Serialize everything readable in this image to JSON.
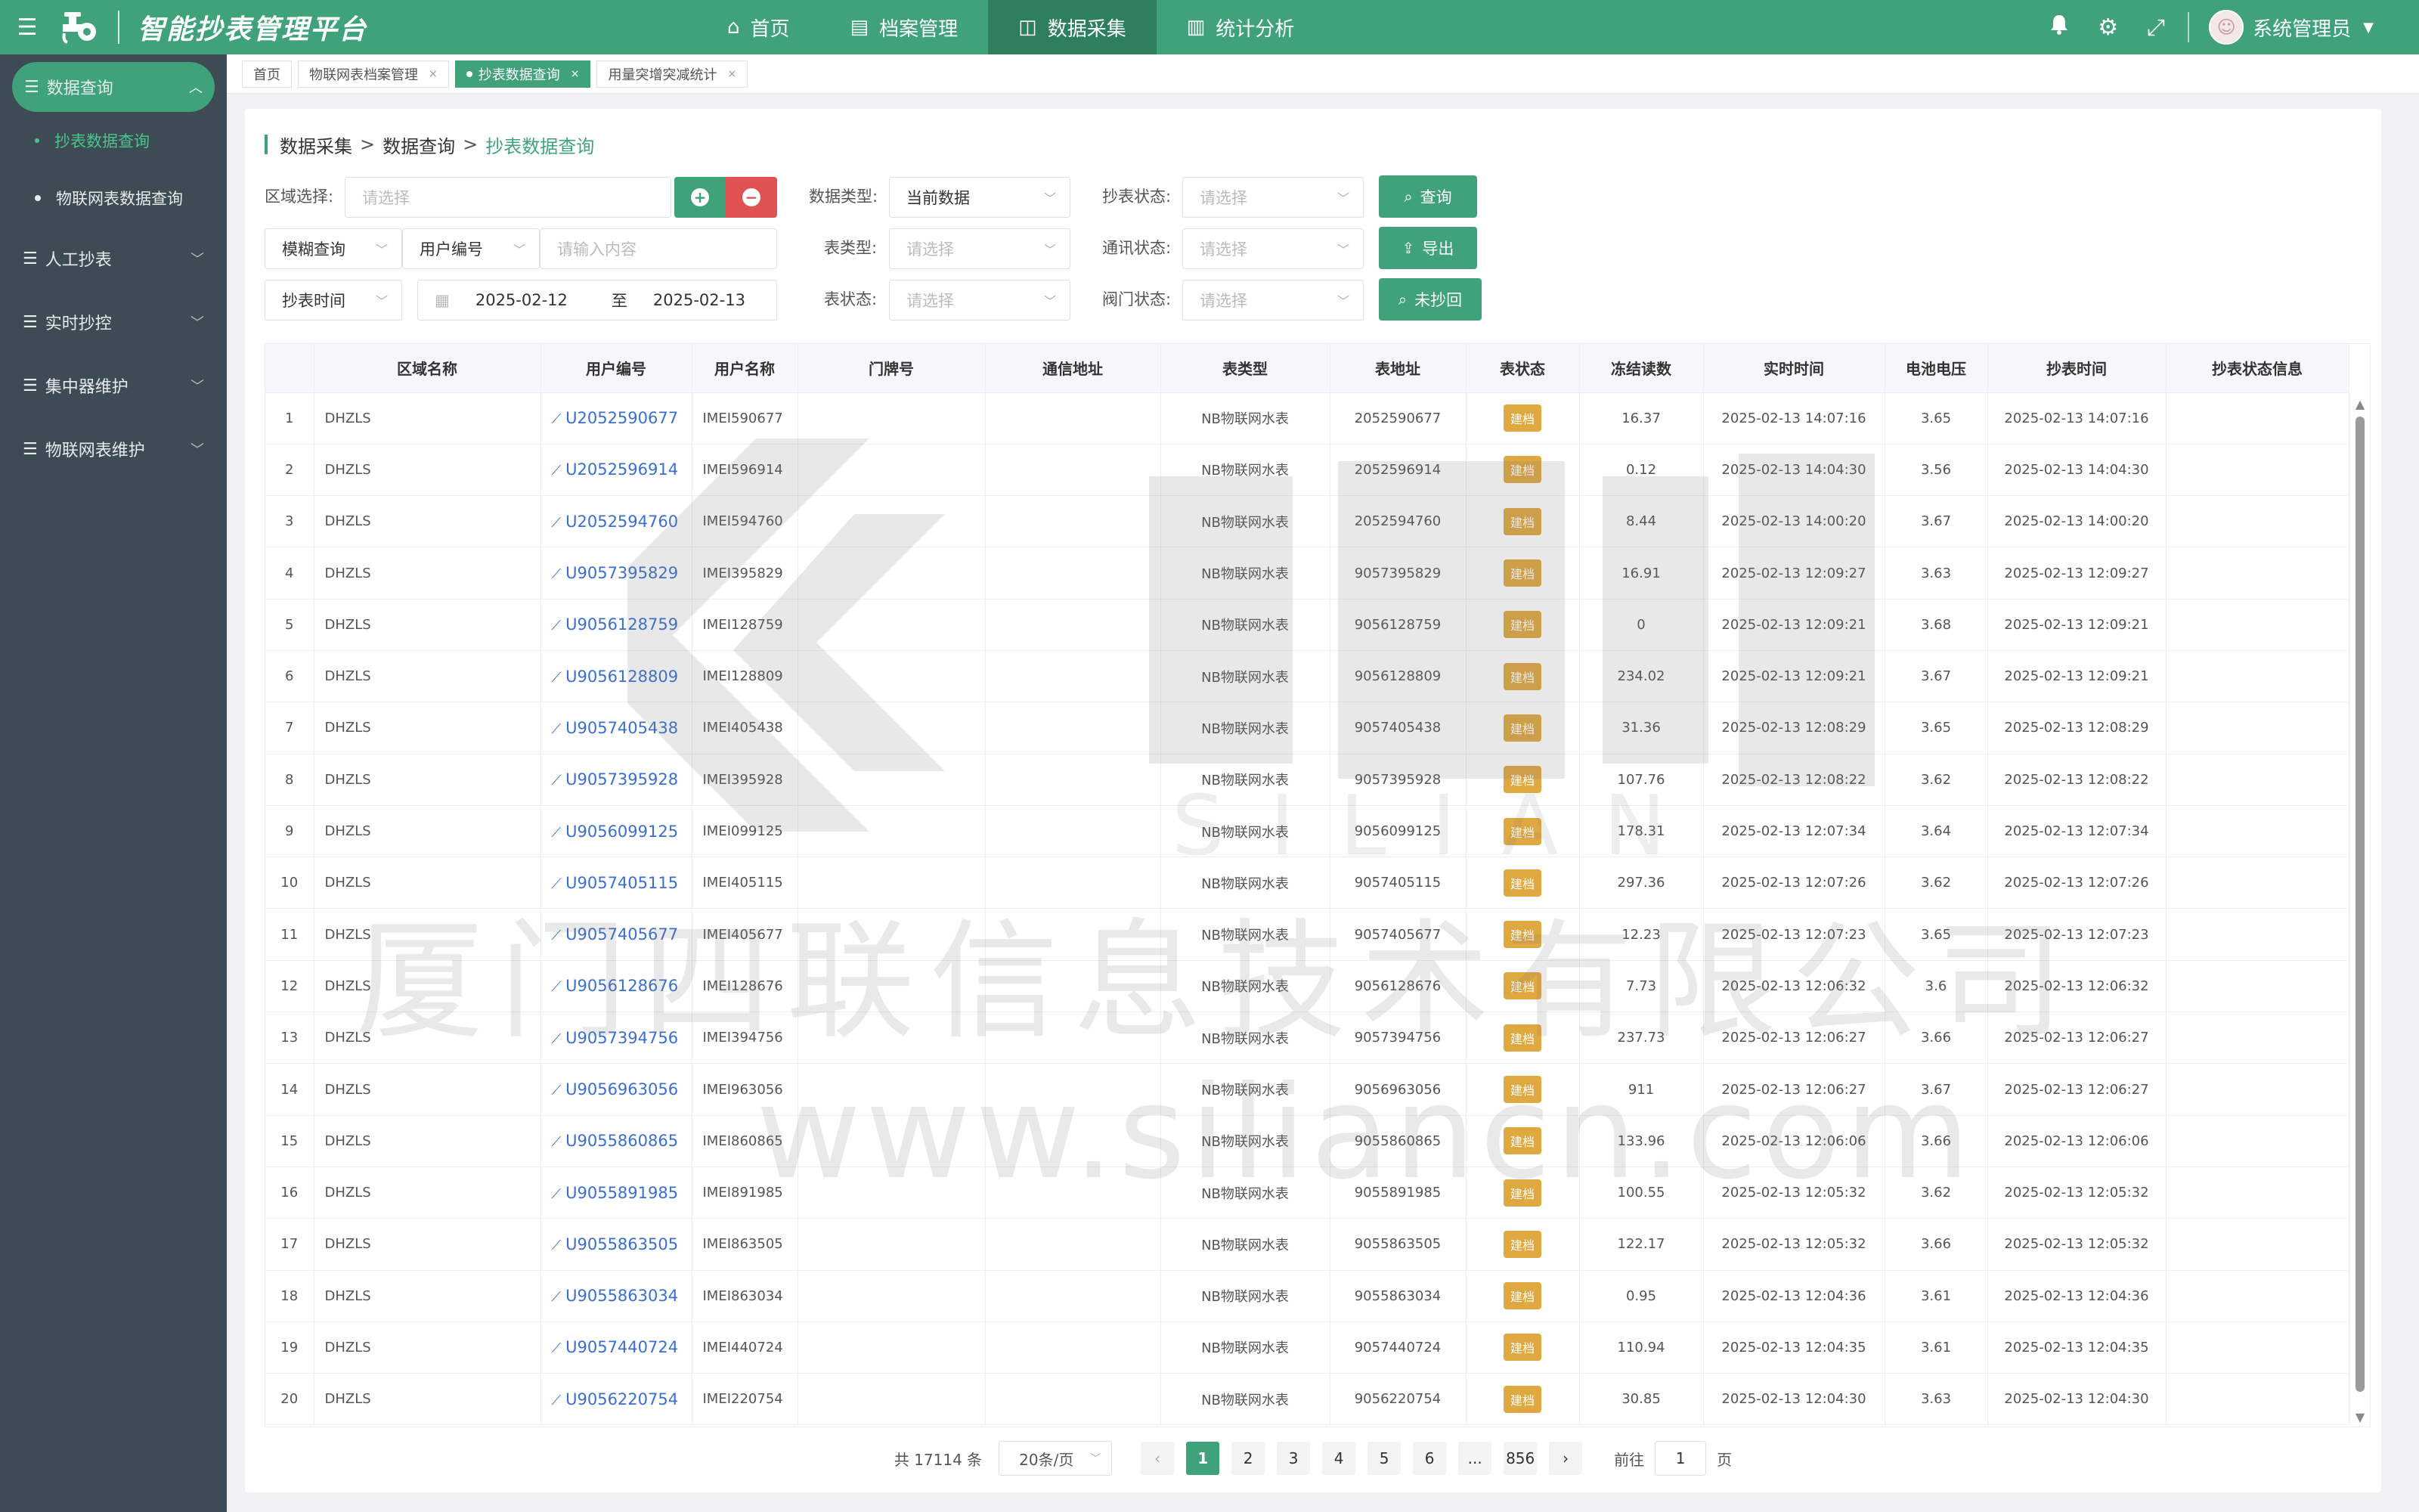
{
  "header": {
    "title": "智能抄表管理平台",
    "nav": [
      {
        "label": "首页",
        "icon": "home-icon",
        "active": false
      },
      {
        "label": "档案管理",
        "icon": "archive-icon",
        "active": false
      },
      {
        "label": "数据采集",
        "icon": "data-collect-icon",
        "active": true
      },
      {
        "label": "统计分析",
        "icon": "chart-icon",
        "active": false
      }
    ],
    "user": "系统管理员"
  },
  "sidebar": {
    "groups": [
      {
        "label": "数据查询",
        "active": true,
        "children": [
          {
            "label": "抄表数据查询",
            "active": true
          },
          {
            "label": "物联网表数据查询",
            "active": false
          }
        ]
      },
      {
        "label": "人工抄表",
        "active": false,
        "children": []
      },
      {
        "label": "实时抄控",
        "active": false,
        "children": []
      },
      {
        "label": "集中器维护",
        "active": false,
        "children": []
      },
      {
        "label": "物联网表维护",
        "active": false,
        "children": []
      }
    ]
  },
  "tabs": [
    {
      "label": "首页",
      "closable": false,
      "active": false
    },
    {
      "label": "物联网表档案管理",
      "closable": true,
      "active": false
    },
    {
      "label": "抄表数据查询",
      "closable": true,
      "active": true
    },
    {
      "label": "用量突增突减统计",
      "closable": true,
      "active": false
    }
  ],
  "breadcrumb": {
    "l1": "数据采集",
    "l2": "数据查询",
    "l3": "抄表数据查询",
    "sep": ">"
  },
  "filters": {
    "region_label": "区域选择:",
    "region_placeholder": "请选择",
    "fuzzy_mode": "模糊查询",
    "fuzzy_field": "用户编号",
    "fuzzy_placeholder": "请输入内容",
    "time_mode": "抄表时间",
    "date_start": "2025-02-12",
    "date_to": "至",
    "date_end": "2025-02-13",
    "data_type_label": "数据类型:",
    "data_type_value": "当前数据",
    "meter_type_label": "表类型:",
    "meter_type_placeholder": "请选择",
    "meter_status_label": "表状态:",
    "meter_status_placeholder": "请选择",
    "read_status_label": "抄表状态:",
    "read_status_placeholder": "请选择",
    "comm_status_label": "通讯状态:",
    "comm_status_placeholder": "请选择",
    "valve_status_label": "阀门状态:",
    "valve_status_placeholder": "请选择",
    "btn_query": "查询",
    "btn_export": "导出",
    "btn_unread": "未抄回"
  },
  "table": {
    "columns": [
      "",
      "区域名称",
      "用户编号",
      "用户名称",
      "门牌号",
      "通信地址",
      "表类型",
      "表地址",
      "表状态",
      "冻结读数",
      "实时时间",
      "电池电压",
      "抄表时间",
      "抄表状态信息"
    ],
    "rows": [
      {
        "idx": "1",
        "region": "DHZLS",
        "user_no": "U2052590677",
        "user_name": "IMEI590677",
        "door": "",
        "comm": "",
        "type": "NB物联网水表",
        "addr": "2052590677",
        "status": "建档",
        "reading": "16.37",
        "rt": "2025-02-13 14:07:16",
        "volt": "3.65",
        "read_time": "2025-02-13 14:07:16",
        "info": ""
      },
      {
        "idx": "2",
        "region": "DHZLS",
        "user_no": "U2052596914",
        "user_name": "IMEI596914",
        "door": "",
        "comm": "",
        "type": "NB物联网水表",
        "addr": "2052596914",
        "status": "建档",
        "reading": "0.12",
        "rt": "2025-02-13 14:04:30",
        "volt": "3.56",
        "read_time": "2025-02-13 14:04:30",
        "info": ""
      },
      {
        "idx": "3",
        "region": "DHZLS",
        "user_no": "U2052594760",
        "user_name": "IMEI594760",
        "door": "",
        "comm": "",
        "type": "NB物联网水表",
        "addr": "2052594760",
        "status": "建档",
        "reading": "8.44",
        "rt": "2025-02-13 14:00:20",
        "volt": "3.67",
        "read_time": "2025-02-13 14:00:20",
        "info": ""
      },
      {
        "idx": "4",
        "region": "DHZLS",
        "user_no": "U9057395829",
        "user_name": "IMEI395829",
        "door": "",
        "comm": "",
        "type": "NB物联网水表",
        "addr": "9057395829",
        "status": "建档",
        "reading": "16.91",
        "rt": "2025-02-13 12:09:27",
        "volt": "3.63",
        "read_time": "2025-02-13 12:09:27",
        "info": ""
      },
      {
        "idx": "5",
        "region": "DHZLS",
        "user_no": "U9056128759",
        "user_name": "IMEI128759",
        "door": "",
        "comm": "",
        "type": "NB物联网水表",
        "addr": "9056128759",
        "status": "建档",
        "reading": "0",
        "rt": "2025-02-13 12:09:21",
        "volt": "3.68",
        "read_time": "2025-02-13 12:09:21",
        "info": ""
      },
      {
        "idx": "6",
        "region": "DHZLS",
        "user_no": "U9056128809",
        "user_name": "IMEI128809",
        "door": "",
        "comm": "",
        "type": "NB物联网水表",
        "addr": "9056128809",
        "status": "建档",
        "reading": "234.02",
        "rt": "2025-02-13 12:09:21",
        "volt": "3.67",
        "read_time": "2025-02-13 12:09:21",
        "info": ""
      },
      {
        "idx": "7",
        "region": "DHZLS",
        "user_no": "U9057405438",
        "user_name": "IMEI405438",
        "door": "",
        "comm": "",
        "type": "NB物联网水表",
        "addr": "9057405438",
        "status": "建档",
        "reading": "31.36",
        "rt": "2025-02-13 12:08:29",
        "volt": "3.65",
        "read_time": "2025-02-13 12:08:29",
        "info": ""
      },
      {
        "idx": "8",
        "region": "DHZLS",
        "user_no": "U9057395928",
        "user_name": "IMEI395928",
        "door": "",
        "comm": "",
        "type": "NB物联网水表",
        "addr": "9057395928",
        "status": "建档",
        "reading": "107.76",
        "rt": "2025-02-13 12:08:22",
        "volt": "3.62",
        "read_time": "2025-02-13 12:08:22",
        "info": ""
      },
      {
        "idx": "9",
        "region": "DHZLS",
        "user_no": "U9056099125",
        "user_name": "IMEI099125",
        "door": "",
        "comm": "",
        "type": "NB物联网水表",
        "addr": "9056099125",
        "status": "建档",
        "reading": "178.31",
        "rt": "2025-02-13 12:07:34",
        "volt": "3.64",
        "read_time": "2025-02-13 12:07:34",
        "info": ""
      },
      {
        "idx": "10",
        "region": "DHZLS",
        "user_no": "U9057405115",
        "user_name": "IMEI405115",
        "door": "",
        "comm": "",
        "type": "NB物联网水表",
        "addr": "9057405115",
        "status": "建档",
        "reading": "297.36",
        "rt": "2025-02-13 12:07:26",
        "volt": "3.62",
        "read_time": "2025-02-13 12:07:26",
        "info": ""
      },
      {
        "idx": "11",
        "region": "DHZLS",
        "user_no": "U9057405677",
        "user_name": "IMEI405677",
        "door": "",
        "comm": "",
        "type": "NB物联网水表",
        "addr": "9057405677",
        "status": "建档",
        "reading": "12.23",
        "rt": "2025-02-13 12:07:23",
        "volt": "3.65",
        "read_time": "2025-02-13 12:07:23",
        "info": ""
      },
      {
        "idx": "12",
        "region": "DHZLS",
        "user_no": "U9056128676",
        "user_name": "IMEI128676",
        "door": "",
        "comm": "",
        "type": "NB物联网水表",
        "addr": "9056128676",
        "status": "建档",
        "reading": "7.73",
        "rt": "2025-02-13 12:06:32",
        "volt": "3.6",
        "read_time": "2025-02-13 12:06:32",
        "info": ""
      },
      {
        "idx": "13",
        "region": "DHZLS",
        "user_no": "U9057394756",
        "user_name": "IMEI394756",
        "door": "",
        "comm": "",
        "type": "NB物联网水表",
        "addr": "9057394756",
        "status": "建档",
        "reading": "237.73",
        "rt": "2025-02-13 12:06:27",
        "volt": "3.66",
        "read_time": "2025-02-13 12:06:27",
        "info": ""
      },
      {
        "idx": "14",
        "region": "DHZLS",
        "user_no": "U9056963056",
        "user_name": "IMEI963056",
        "door": "",
        "comm": "",
        "type": "NB物联网水表",
        "addr": "9056963056",
        "status": "建档",
        "reading": "911",
        "rt": "2025-02-13 12:06:27",
        "volt": "3.67",
        "read_time": "2025-02-13 12:06:27",
        "info": ""
      },
      {
        "idx": "15",
        "region": "DHZLS",
        "user_no": "U9055860865",
        "user_name": "IMEI860865",
        "door": "",
        "comm": "",
        "type": "NB物联网水表",
        "addr": "9055860865",
        "status": "建档",
        "reading": "133.96",
        "rt": "2025-02-13 12:06:06",
        "volt": "3.66",
        "read_time": "2025-02-13 12:06:06",
        "info": ""
      },
      {
        "idx": "16",
        "region": "DHZLS",
        "user_no": "U9055891985",
        "user_name": "IMEI891985",
        "door": "",
        "comm": "",
        "type": "NB物联网水表",
        "addr": "9055891985",
        "status": "建档",
        "reading": "100.55",
        "rt": "2025-02-13 12:05:32",
        "volt": "3.62",
        "read_time": "2025-02-13 12:05:32",
        "info": ""
      },
      {
        "idx": "17",
        "region": "DHZLS",
        "user_no": "U9055863505",
        "user_name": "IMEI863505",
        "door": "",
        "comm": "",
        "type": "NB物联网水表",
        "addr": "9055863505",
        "status": "建档",
        "reading": "122.17",
        "rt": "2025-02-13 12:05:32",
        "volt": "3.66",
        "read_time": "2025-02-13 12:05:32",
        "info": ""
      },
      {
        "idx": "18",
        "region": "DHZLS",
        "user_no": "U9055863034",
        "user_name": "IMEI863034",
        "door": "",
        "comm": "",
        "type": "NB物联网水表",
        "addr": "9055863034",
        "status": "建档",
        "reading": "0.95",
        "rt": "2025-02-13 12:04:36",
        "volt": "3.61",
        "read_time": "2025-02-13 12:04:36",
        "info": ""
      },
      {
        "idx": "19",
        "region": "DHZLS",
        "user_no": "U9057440724",
        "user_name": "IMEI440724",
        "door": "",
        "comm": "",
        "type": "NB物联网水表",
        "addr": "9057440724",
        "status": "建档",
        "reading": "110.94",
        "rt": "2025-02-13 12:04:35",
        "volt": "3.61",
        "read_time": "2025-02-13 12:04:35",
        "info": ""
      },
      {
        "idx": "20",
        "region": "DHZLS",
        "user_no": "U9056220754",
        "user_name": "IMEI220754",
        "door": "",
        "comm": "",
        "type": "NB物联网水表",
        "addr": "9056220754",
        "status": "建档",
        "reading": "30.85",
        "rt": "2025-02-13 12:04:30",
        "volt": "3.63",
        "read_time": "2025-02-13 12:04:30",
        "info": ""
      }
    ]
  },
  "pagination": {
    "total": "共 17114 条",
    "page_size": "20条/页",
    "pages": [
      "1",
      "2",
      "3",
      "4",
      "5",
      "6",
      "...",
      "856"
    ],
    "current": "1",
    "goto_label": "前往",
    "goto_value": "1",
    "goto_suffix": "页"
  },
  "watermark": {
    "line1": "厦门四联信息技术有限公司",
    "line2": "www.siliancn.com"
  },
  "colors": {
    "primary": "#3fa27a",
    "sidebar": "#3d4c54",
    "danger": "#e05151",
    "badge": "#e0a841",
    "link": "#3a6fd1"
  }
}
